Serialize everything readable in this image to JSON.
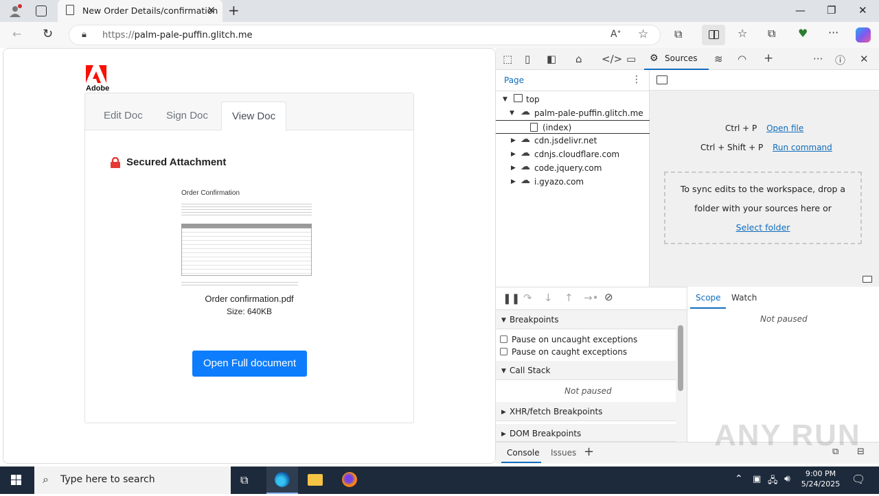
{
  "browser": {
    "tab_title": "New Order Details/confirmation",
    "url_host": "palm-pale-puffin.glitch.me",
    "url_scheme": "https://"
  },
  "page": {
    "logo_text": "Adobe",
    "tabs": [
      {
        "label": "Edit Doc",
        "active": false
      },
      {
        "label": "Sign Doc",
        "active": false
      },
      {
        "label": "View Doc",
        "active": true
      }
    ],
    "secured_label": "Secured Attachment",
    "thumbnail_title": "Order Confirmation",
    "file_name": "Order confirmation.pdf",
    "file_size": "Size: 640KB",
    "open_button": "Open Full document",
    "accent_color": "#0d7dfd"
  },
  "devtools": {
    "active_panel": "Sources",
    "nav_tab": "Page",
    "tree": [
      {
        "label": "top",
        "level": 0,
        "expanded": true
      },
      {
        "label": "palm-pale-puffin.glitch.me",
        "level": 1,
        "expanded": true
      },
      {
        "label": "(index)",
        "level": 2
      },
      {
        "label": "cdn.jsdelivr.net",
        "level": 1,
        "expanded": false
      },
      {
        "label": "cdnjs.cloudflare.com",
        "level": 1,
        "expanded": false
      },
      {
        "label": "code.jquery.com",
        "level": 1,
        "expanded": false
      },
      {
        "label": "i.gyazo.com",
        "level": 1,
        "expanded": false
      }
    ],
    "shortcuts": [
      {
        "keys": "Ctrl + P",
        "action": "Open file"
      },
      {
        "keys": "Ctrl + Shift + P",
        "action": "Run command"
      }
    ],
    "drop_text_1": "To sync edits to the workspace, drop a",
    "drop_text_2": "folder with your sources here or",
    "drop_link": "Select folder",
    "breakpoints_label": "Breakpoints",
    "pause_uncaught": "Pause on uncaught exceptions",
    "pause_caught": "Pause on caught exceptions",
    "call_stack_label": "Call Stack",
    "not_paused": "Not paused",
    "xhr_label": "XHR/fetch Breakpoints",
    "dom_label": "DOM Breakpoints",
    "scope_tab": "Scope",
    "watch_tab": "Watch",
    "drawer_console": "Console",
    "drawer_issues": "Issues"
  },
  "taskbar": {
    "search_placeholder": "Type here to search",
    "time": "9:00 PM",
    "date": "5/24/2025"
  },
  "watermark": "ANY RUN"
}
